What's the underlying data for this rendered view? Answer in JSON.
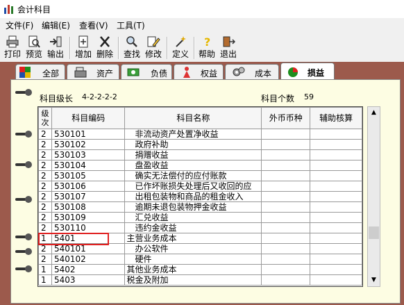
{
  "window": {
    "title": "会计科目"
  },
  "menu": [
    "文件(F)",
    "编辑(E)",
    "查看(V)",
    "工具(T)"
  ],
  "toolbar": [
    {
      "label": "打印",
      "icon": "printer-icon"
    },
    {
      "label": "预览",
      "icon": "preview-icon"
    },
    {
      "label": "输出",
      "icon": "export-icon"
    },
    {
      "label": "增加",
      "icon": "add-icon"
    },
    {
      "label": "删除",
      "icon": "delete-icon"
    },
    {
      "label": "查找",
      "icon": "find-icon"
    },
    {
      "label": "修改",
      "icon": "edit-icon"
    },
    {
      "label": "定义",
      "icon": "define-icon"
    },
    {
      "label": "帮助",
      "icon": "help-icon"
    },
    {
      "label": "退出",
      "icon": "exit-icon"
    }
  ],
  "tabs": [
    "全部",
    "资产",
    "负债",
    "权益",
    "成本",
    "损益"
  ],
  "active_tab": "损益",
  "info": {
    "level_label": "科目级长",
    "level_value": "4-2-2-2-2",
    "count_label": "科目个数",
    "count_value": "59"
  },
  "columns": [
    "级次",
    "科目编码",
    "科目名称",
    "外币币种",
    "辅助核算"
  ],
  "rows": [
    {
      "level": "2",
      "code": "530101",
      "name": "非流动资产处置净收益",
      "indent": true
    },
    {
      "level": "2",
      "code": "530102",
      "name": "政府补助",
      "indent": true
    },
    {
      "level": "2",
      "code": "530103",
      "name": "捐赠收益",
      "indent": true
    },
    {
      "level": "2",
      "code": "530104",
      "name": "盘盈收益",
      "indent": true
    },
    {
      "level": "2",
      "code": "530105",
      "name": "确实无法偿付的应付账款",
      "indent": true
    },
    {
      "level": "2",
      "code": "530106",
      "name": "已作坏账损失处理后又收回的应",
      "indent": true
    },
    {
      "level": "2",
      "code": "530107",
      "name": "出租包装物和商品的租金收入",
      "indent": true
    },
    {
      "level": "2",
      "code": "530108",
      "name": "逾期未退包装物押金收益",
      "indent": true
    },
    {
      "level": "2",
      "code": "530109",
      "name": "汇兑收益",
      "indent": true
    },
    {
      "level": "2",
      "code": "530110",
      "name": "违约金收益",
      "indent": true
    },
    {
      "level": "1",
      "code": "5401",
      "name": "主营业务成本",
      "indent": false
    },
    {
      "level": "2",
      "code": "540101",
      "name": "办公软件",
      "indent": true
    },
    {
      "level": "2",
      "code": "540102",
      "name": "硬件",
      "indent": true
    },
    {
      "level": "1",
      "code": "5402",
      "name": "其他业务成本",
      "indent": false
    },
    {
      "level": "1",
      "code": "5403",
      "name": "税金及附加",
      "indent": false
    }
  ],
  "colors": {
    "workspace": "#9c5a4c",
    "notebook": "#fdfde3",
    "highlight": "#e02020"
  }
}
